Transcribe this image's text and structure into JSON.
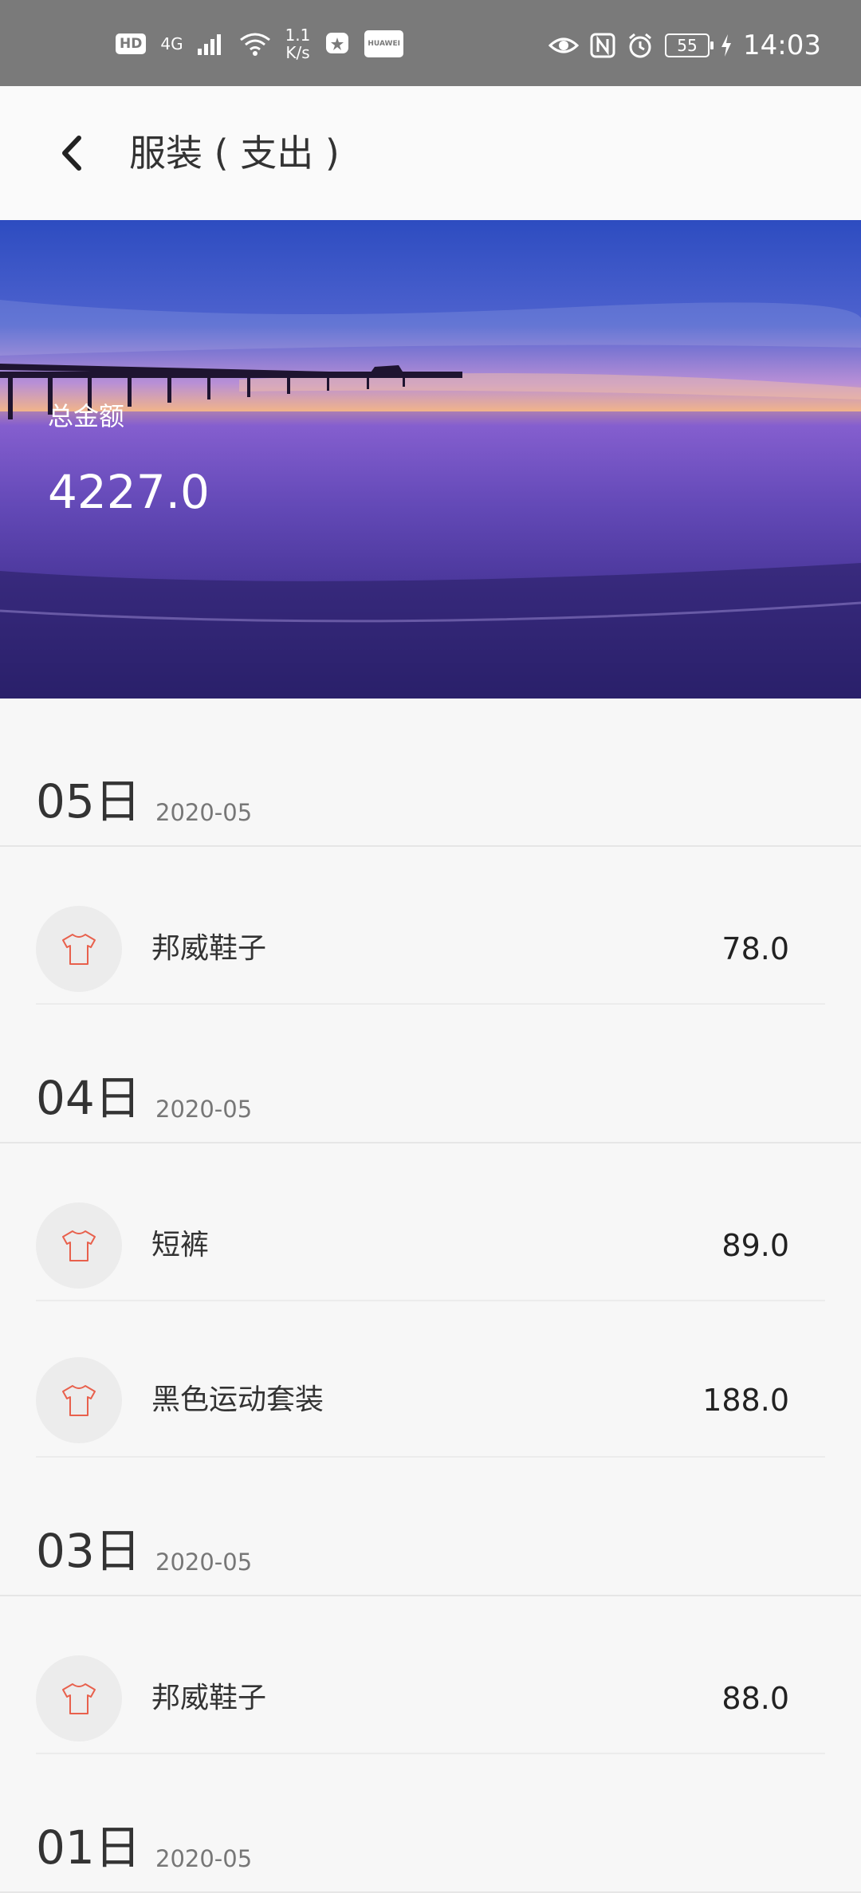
{
  "status_bar": {
    "hd": "HD",
    "network": "4G",
    "speed_value": "1.1",
    "speed_unit": "K/s",
    "huawei_label": "HUAWEI",
    "battery": "55",
    "time": "14:03"
  },
  "header": {
    "title": "服装 ( 支出 )"
  },
  "banner": {
    "total_label": "总金额",
    "total_value": "4227.0"
  },
  "groups": [
    {
      "day": "05日",
      "month": "2020-05",
      "items": [
        {
          "name": "邦威鞋子",
          "amount": "78.0",
          "icon": "tshirt-icon"
        }
      ]
    },
    {
      "day": "04日",
      "month": "2020-05",
      "items": [
        {
          "name": "短裤",
          "amount": "89.0",
          "icon": "tshirt-icon"
        },
        {
          "name": "黑色运动套装",
          "amount": "188.0",
          "icon": "tshirt-icon"
        }
      ]
    },
    {
      "day": "03日",
      "month": "2020-05",
      "items": [
        {
          "name": "邦威鞋子",
          "amount": "88.0",
          "icon": "tshirt-icon"
        }
      ]
    },
    {
      "day": "01日",
      "month": "2020-05",
      "items": []
    }
  ],
  "colors": {
    "icon_accent": "#e8604c",
    "status_bar": "#7a7a7a"
  }
}
